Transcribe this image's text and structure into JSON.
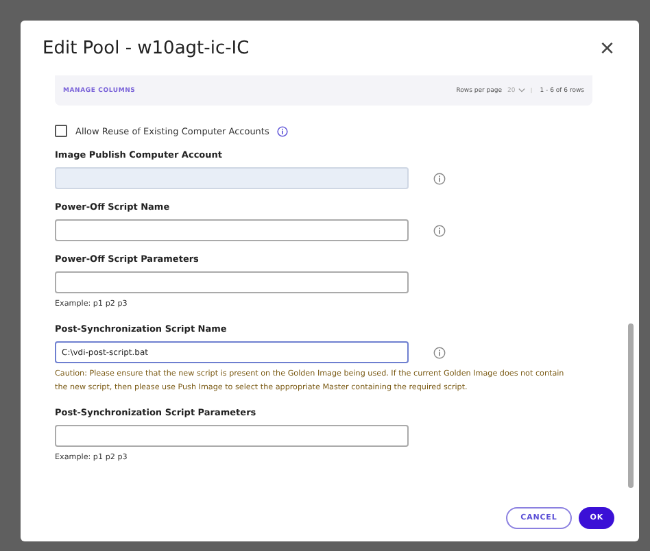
{
  "dialog": {
    "title": "Edit Pool - w10agt-ic-IC",
    "close": "×"
  },
  "table_footer": {
    "manage_columns": "MANAGE COLUMNS",
    "rows_per_page_label": "Rows per page",
    "rows_per_page_value": "20",
    "range": "1 - 6 of 6 rows"
  },
  "checkbox": {
    "label": "Allow Reuse of Existing Computer Accounts",
    "checked": false,
    "info": true
  },
  "fields": [
    {
      "label": "Image Publish Computer Account",
      "disabled": true,
      "focused": false,
      "info": true
    },
    {
      "label": "Power-Off Script Name",
      "disabled": false,
      "focused": false,
      "info": true
    },
    {
      "label": "Power-Off Script Parameters",
      "disabled": false,
      "focused": false,
      "info": false,
      "notes": [
        {
          "kind": "example",
          "text": "Example: p1 p2 p3"
        }
      ]
    },
    {
      "label": "Post-Synchronization Script Name",
      "value": "C:\\vdi-post-script.bat",
      "disabled": false,
      "focused": true,
      "info": true,
      "notes": [
        {
          "kind": "caution",
          "text": "Caution: Please ensure that the new script is present on the Golden Image being used. If the current Golden Image does not contain the new script, then please use Push Image to select the appropriate Master containing the required script."
        }
      ]
    },
    {
      "label": "Post-Synchronization Script Parameters",
      "disabled": false,
      "focused": false,
      "info": false,
      "notes": [
        {
          "kind": "example",
          "text": "Example: p1 p2 p3"
        }
      ]
    }
  ],
  "buttons": [
    {
      "label": "CANCEL",
      "kind": "secondary"
    },
    {
      "label": "OK",
      "kind": "primary"
    }
  ]
}
